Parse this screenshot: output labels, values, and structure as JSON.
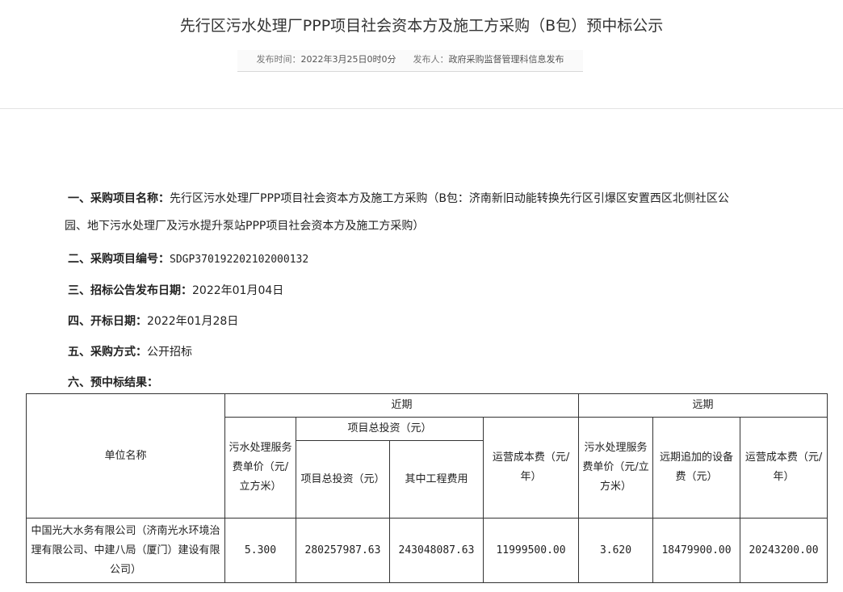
{
  "header": {
    "title": "先行区污水处理厂PPP项目社会资本方及施工方采购（B包）预中标公示",
    "publish_time_label": "发布时间：",
    "publish_time": "2022年3月25日0时0分",
    "publisher_label": "发布人：",
    "publisher": "政府采购监督管理科信息发布"
  },
  "items": [
    {
      "label": "一、采购项目名称：",
      "value_line1": "先行区污水处理厂PPP项目社会资本方及施工方采购（B包：济南新旧动能转换先行区引爆区安置西区北侧社区公",
      "value_line2": "园、地下污水处理厂及污水提升泵站PPP项目社会资本方及施工方采购）"
    },
    {
      "label": "二、采购项目编号：",
      "value": "SDGP370192202102000132"
    },
    {
      "label": "三、招标公告发布日期：",
      "value": "2022年01月04日"
    },
    {
      "label": "四、开标日期：",
      "value": "2022年01月28日"
    },
    {
      "label": "五、采购方式：",
      "value": "公开招标"
    },
    {
      "label": "六、预中标结果：",
      "value": ""
    }
  ],
  "table": {
    "col_unit": "单位名称",
    "group_near": "近期",
    "group_far": "远期",
    "near_fee": "污水处理服务费单价（元/立方米）",
    "invest_group": "项目总投资（元）",
    "invest_total": "项目总投资（元）",
    "invest_engineering": "其中工程费用",
    "near_op_cost": "运营成本费（元/年）",
    "far_fee": "污水处理服务费单价（元/立方米）",
    "far_equipment": "远期追加的设备费（元）",
    "far_op_cost": "运营成本费（元/年）",
    "rows": [
      {
        "unit": "中国光大水务有限公司（济南光水环境治理有限公司、中建八局（厦门）建设有限公司）",
        "near_fee": "5.300",
        "invest_total": "280257987.63",
        "invest_engineering": "243048087.63",
        "near_op_cost": "11999500.00",
        "far_fee": "3.620",
        "far_equipment": "18479900.00",
        "far_op_cost": "20243200.00"
      }
    ]
  }
}
